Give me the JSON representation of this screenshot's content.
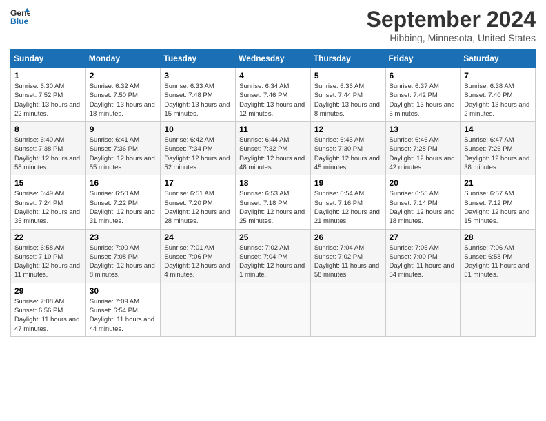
{
  "header": {
    "logo_line1": "General",
    "logo_line2": "Blue",
    "month": "September 2024",
    "location": "Hibbing, Minnesota, United States"
  },
  "weekdays": [
    "Sunday",
    "Monday",
    "Tuesday",
    "Wednesday",
    "Thursday",
    "Friday",
    "Saturday"
  ],
  "weeks": [
    [
      {
        "day": "1",
        "sunrise": "6:30 AM",
        "sunset": "7:52 PM",
        "daylight": "13 hours and 22 minutes."
      },
      {
        "day": "2",
        "sunrise": "6:32 AM",
        "sunset": "7:50 PM",
        "daylight": "13 hours and 18 minutes."
      },
      {
        "day": "3",
        "sunrise": "6:33 AM",
        "sunset": "7:48 PM",
        "daylight": "13 hours and 15 minutes."
      },
      {
        "day": "4",
        "sunrise": "6:34 AM",
        "sunset": "7:46 PM",
        "daylight": "13 hours and 12 minutes."
      },
      {
        "day": "5",
        "sunrise": "6:36 AM",
        "sunset": "7:44 PM",
        "daylight": "13 hours and 8 minutes."
      },
      {
        "day": "6",
        "sunrise": "6:37 AM",
        "sunset": "7:42 PM",
        "daylight": "13 hours and 5 minutes."
      },
      {
        "day": "7",
        "sunrise": "6:38 AM",
        "sunset": "7:40 PM",
        "daylight": "13 hours and 2 minutes."
      }
    ],
    [
      {
        "day": "8",
        "sunrise": "6:40 AM",
        "sunset": "7:38 PM",
        "daylight": "12 hours and 58 minutes."
      },
      {
        "day": "9",
        "sunrise": "6:41 AM",
        "sunset": "7:36 PM",
        "daylight": "12 hours and 55 minutes."
      },
      {
        "day": "10",
        "sunrise": "6:42 AM",
        "sunset": "7:34 PM",
        "daylight": "12 hours and 52 minutes."
      },
      {
        "day": "11",
        "sunrise": "6:44 AM",
        "sunset": "7:32 PM",
        "daylight": "12 hours and 48 minutes."
      },
      {
        "day": "12",
        "sunrise": "6:45 AM",
        "sunset": "7:30 PM",
        "daylight": "12 hours and 45 minutes."
      },
      {
        "day": "13",
        "sunrise": "6:46 AM",
        "sunset": "7:28 PM",
        "daylight": "12 hours and 42 minutes."
      },
      {
        "day": "14",
        "sunrise": "6:47 AM",
        "sunset": "7:26 PM",
        "daylight": "12 hours and 38 minutes."
      }
    ],
    [
      {
        "day": "15",
        "sunrise": "6:49 AM",
        "sunset": "7:24 PM",
        "daylight": "12 hours and 35 minutes."
      },
      {
        "day": "16",
        "sunrise": "6:50 AM",
        "sunset": "7:22 PM",
        "daylight": "12 hours and 31 minutes."
      },
      {
        "day": "17",
        "sunrise": "6:51 AM",
        "sunset": "7:20 PM",
        "daylight": "12 hours and 28 minutes."
      },
      {
        "day": "18",
        "sunrise": "6:53 AM",
        "sunset": "7:18 PM",
        "daylight": "12 hours and 25 minutes."
      },
      {
        "day": "19",
        "sunrise": "6:54 AM",
        "sunset": "7:16 PM",
        "daylight": "12 hours and 21 minutes."
      },
      {
        "day": "20",
        "sunrise": "6:55 AM",
        "sunset": "7:14 PM",
        "daylight": "12 hours and 18 minutes."
      },
      {
        "day": "21",
        "sunrise": "6:57 AM",
        "sunset": "7:12 PM",
        "daylight": "12 hours and 15 minutes."
      }
    ],
    [
      {
        "day": "22",
        "sunrise": "6:58 AM",
        "sunset": "7:10 PM",
        "daylight": "12 hours and 11 minutes."
      },
      {
        "day": "23",
        "sunrise": "7:00 AM",
        "sunset": "7:08 PM",
        "daylight": "12 hours and 8 minutes."
      },
      {
        "day": "24",
        "sunrise": "7:01 AM",
        "sunset": "7:06 PM",
        "daylight": "12 hours and 4 minutes."
      },
      {
        "day": "25",
        "sunrise": "7:02 AM",
        "sunset": "7:04 PM",
        "daylight": "12 hours and 1 minute."
      },
      {
        "day": "26",
        "sunrise": "7:04 AM",
        "sunset": "7:02 PM",
        "daylight": "11 hours and 58 minutes."
      },
      {
        "day": "27",
        "sunrise": "7:05 AM",
        "sunset": "7:00 PM",
        "daylight": "11 hours and 54 minutes."
      },
      {
        "day": "28",
        "sunrise": "7:06 AM",
        "sunset": "6:58 PM",
        "daylight": "11 hours and 51 minutes."
      }
    ],
    [
      {
        "day": "29",
        "sunrise": "7:08 AM",
        "sunset": "6:56 PM",
        "daylight": "11 hours and 47 minutes."
      },
      {
        "day": "30",
        "sunrise": "7:09 AM",
        "sunset": "6:54 PM",
        "daylight": "11 hours and 44 minutes."
      },
      null,
      null,
      null,
      null,
      null
    ]
  ]
}
